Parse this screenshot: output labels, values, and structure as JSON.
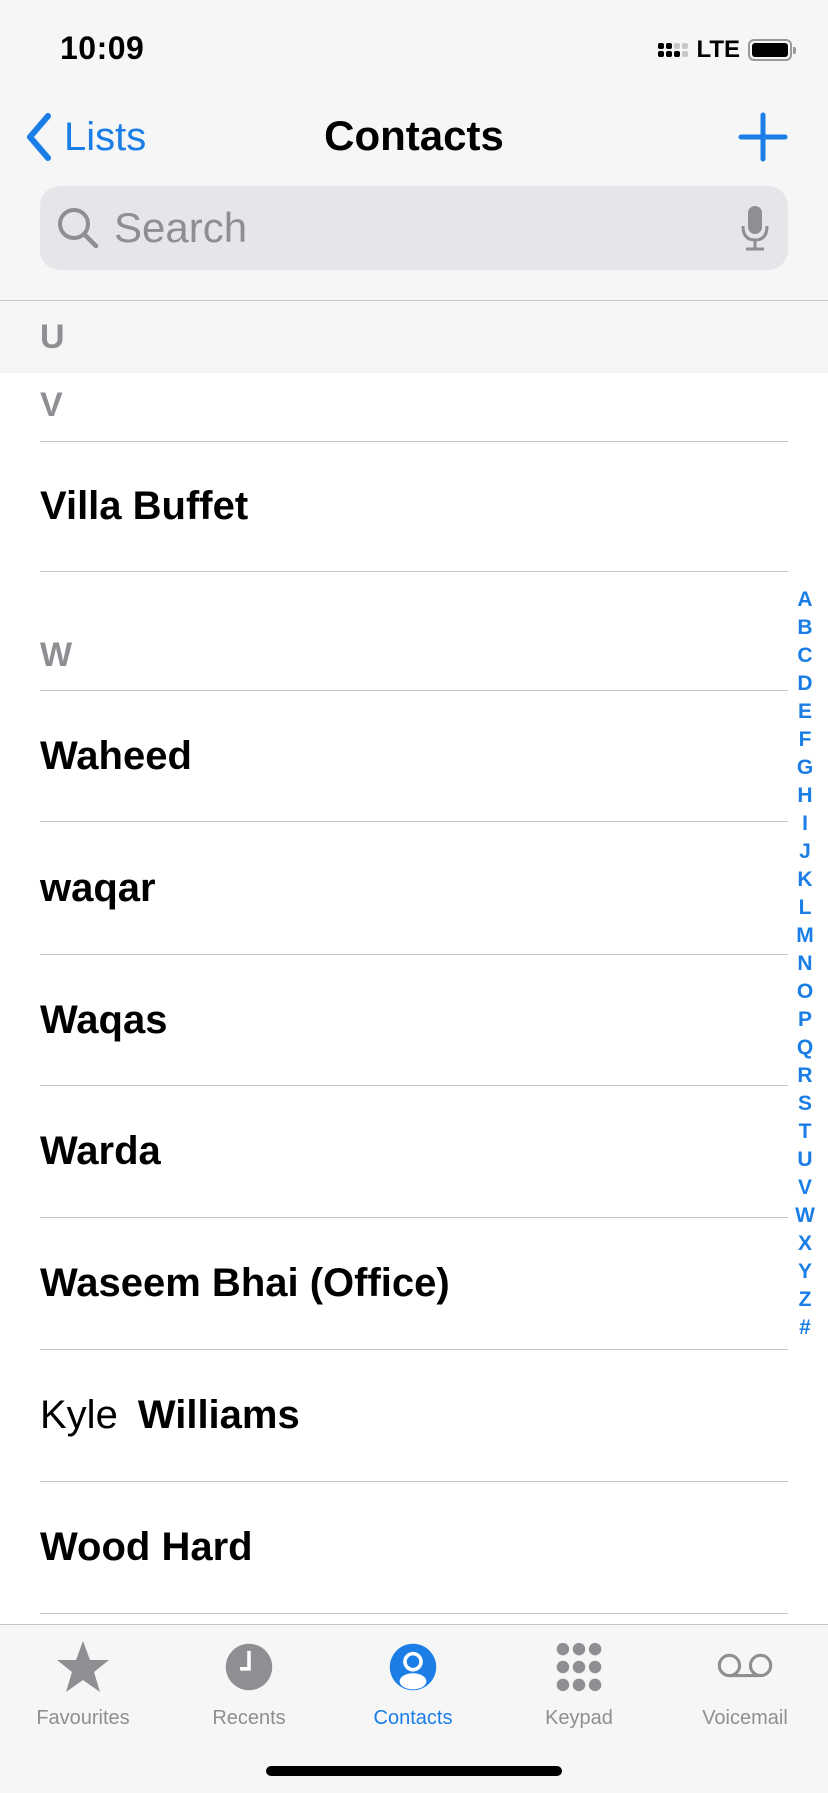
{
  "status_bar": {
    "time": "10:09",
    "network": "LTE",
    "battery_icon": "battery-full-icon",
    "signal_icon": "signal-icon"
  },
  "nav": {
    "back_label": "Lists",
    "title": "Contacts",
    "add_icon": "plus-icon"
  },
  "search": {
    "placeholder": "Search",
    "value": ""
  },
  "sections": [
    {
      "letter": "U",
      "contacts": []
    },
    {
      "letter": "V",
      "contacts": [
        {
          "first": "",
          "last": "Villa Buffet"
        }
      ]
    },
    {
      "letter": "W",
      "contacts": [
        {
          "first": "",
          "last": "Waheed"
        },
        {
          "first": "",
          "last": "waqar"
        },
        {
          "first": "",
          "last": "Waqas"
        },
        {
          "first": "",
          "last": "Warda"
        },
        {
          "first": "",
          "last": "Waseem Bhai (Office)"
        },
        {
          "first": "Kyle",
          "last": "Williams"
        },
        {
          "first": "",
          "last": "Wood Hard"
        }
      ]
    }
  ],
  "index_letters": [
    "A",
    "B",
    "C",
    "D",
    "E",
    "F",
    "G",
    "H",
    "I",
    "J",
    "K",
    "L",
    "M",
    "N",
    "O",
    "P",
    "Q",
    "R",
    "S",
    "T",
    "U",
    "V",
    "W",
    "X",
    "Y",
    "Z",
    "#"
  ],
  "tabs": [
    {
      "label": "Favourites",
      "icon": "star-icon",
      "active": false
    },
    {
      "label": "Recents",
      "icon": "clock-icon",
      "active": false
    },
    {
      "label": "Contacts",
      "icon": "person-circle-icon",
      "active": true
    },
    {
      "label": "Keypad",
      "icon": "keypad-icon",
      "active": false
    },
    {
      "label": "Voicemail",
      "icon": "voicemail-icon",
      "active": false
    }
  ],
  "colors": {
    "accent": "#1a7ee6",
    "secondary_text": "#8e8e93",
    "separator": "#c6c6c8",
    "bar_bg": "#f6f6f6"
  }
}
